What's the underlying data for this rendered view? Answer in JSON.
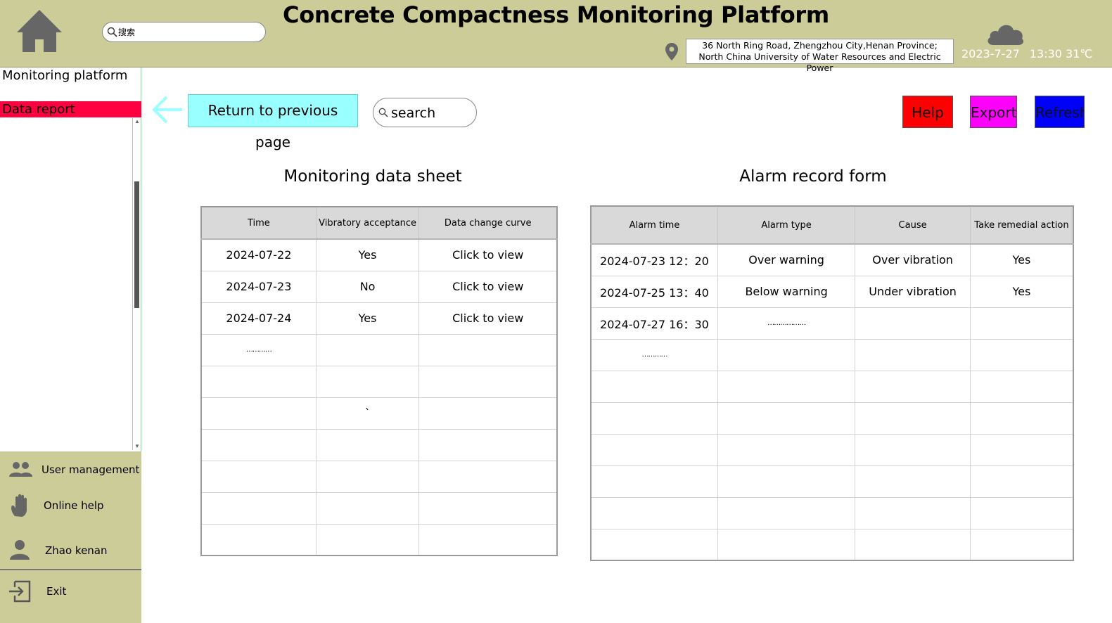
{
  "header": {
    "title": "Concrete Compactness Monitoring Platform",
    "search_placeholder": "搜索",
    "address_line1": "36 North Ring Road, Zhengzhou City,Henan Province;",
    "address_line2": "North China University of Water Resources and Electric Power",
    "date": "2023-7-27",
    "time_temp": "13:30 31℃",
    "icons": [
      "home-icon",
      "search-icon",
      "location-pin-icon",
      "cloud-icon"
    ]
  },
  "sidebar": {
    "items": [
      {
        "label": "Monitoring platform"
      },
      {
        "label": "Data report",
        "active": true
      }
    ],
    "bottom_menu": [
      {
        "label": "User management",
        "icon": "users-icon"
      },
      {
        "label": "Online help",
        "icon": "hand-icon"
      },
      {
        "label": "Zhao kenan",
        "icon": "user-icon"
      },
      {
        "label": "Exit",
        "icon": "exit-icon"
      }
    ]
  },
  "toolbar": {
    "return_label": "Return to previous page",
    "search_placeholder": "search",
    "help_label": "Help",
    "export_label": "Export",
    "refresh_label": "Refresh",
    "colors": {
      "return": "#99ffff",
      "help": "#ff0000",
      "export": "#ff00ff",
      "refresh": "#0000ff",
      "active_nav": "#ff0040",
      "header_bg": "#cccc99"
    }
  },
  "monitoring_table": {
    "title": "Monitoring data sheet",
    "columns": [
      "Time",
      "Vibratory acceptance",
      "Data change curve"
    ],
    "rows": [
      [
        "2024-07-22",
        "Yes",
        "Click to view"
      ],
      [
        "2024-07-23",
        "No",
        "Click to view"
      ],
      [
        "2024-07-24",
        "Yes",
        "Click to view"
      ],
      [
        "…………",
        "",
        ""
      ],
      [
        "",
        "",
        ""
      ],
      [
        "",
        "`",
        ""
      ],
      [
        "",
        "",
        ""
      ],
      [
        "",
        "",
        ""
      ],
      [
        "",
        "",
        ""
      ],
      [
        "",
        "",
        ""
      ]
    ]
  },
  "alarm_table": {
    "title": "Alarm record form",
    "columns": [
      "Alarm time",
      "Alarm type",
      "Cause",
      "Take remedial action"
    ],
    "rows": [
      [
        "2024-07-23 12：20",
        "Over warning",
        "Over vibration",
        "Yes"
      ],
      [
        "2024-07-25 13：40",
        "Below warning",
        "Under vibration",
        "Yes"
      ],
      [
        "2024-07-27 16：30",
        "………………",
        "",
        ""
      ],
      [
        "…………",
        "",
        "",
        ""
      ],
      [
        "",
        "",
        "",
        ""
      ],
      [
        "",
        "",
        "",
        ""
      ],
      [
        "",
        "",
        "",
        ""
      ],
      [
        "",
        "",
        "",
        ""
      ],
      [
        "",
        "",
        "",
        ""
      ],
      [
        "",
        "",
        "",
        ""
      ]
    ]
  }
}
